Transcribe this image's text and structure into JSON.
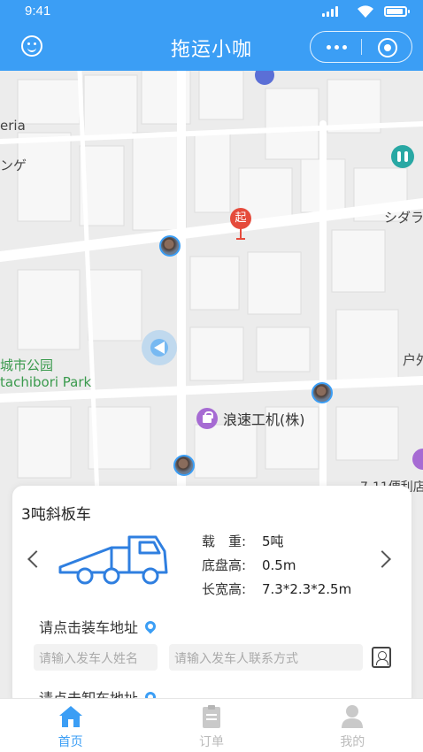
{
  "status_bar": {
    "time": "9:41"
  },
  "header": {
    "title": "拖运小咖"
  },
  "map": {
    "labels": {
      "eria": "eria",
      "nge": "ンゲ",
      "shidara": "シダラ",
      "park_cn": "城市公园",
      "park_en": "tachibori Park",
      "seven_eleven": "7-11便利店",
      "he": "户外"
    },
    "poi_name": "浪速工机(株)",
    "start_marker": "起"
  },
  "card": {
    "vehicle_name": "3吨斜板车",
    "specs": [
      {
        "label": "载　重:",
        "value": "5吨"
      },
      {
        "label": "底盘高:",
        "value": "0.5m"
      },
      {
        "label": "长宽高:",
        "value": "7.3*2.3*2.5m"
      }
    ],
    "load_address_prompt": "请点击装车地址",
    "sender_name_placeholder": "请输入发车人姓名",
    "sender_phone_placeholder": "请输入发车人联系方式",
    "unload_address_prompt": "请点击卸车地址"
  },
  "tabs": [
    {
      "label": "首页",
      "active": true
    },
    {
      "label": "订单",
      "active": false
    },
    {
      "label": "我的",
      "active": false
    }
  ],
  "colors": {
    "primary": "#3b9ef5",
    "start_pin": "#e54b3c",
    "poi_purple": "#a66bd3"
  }
}
